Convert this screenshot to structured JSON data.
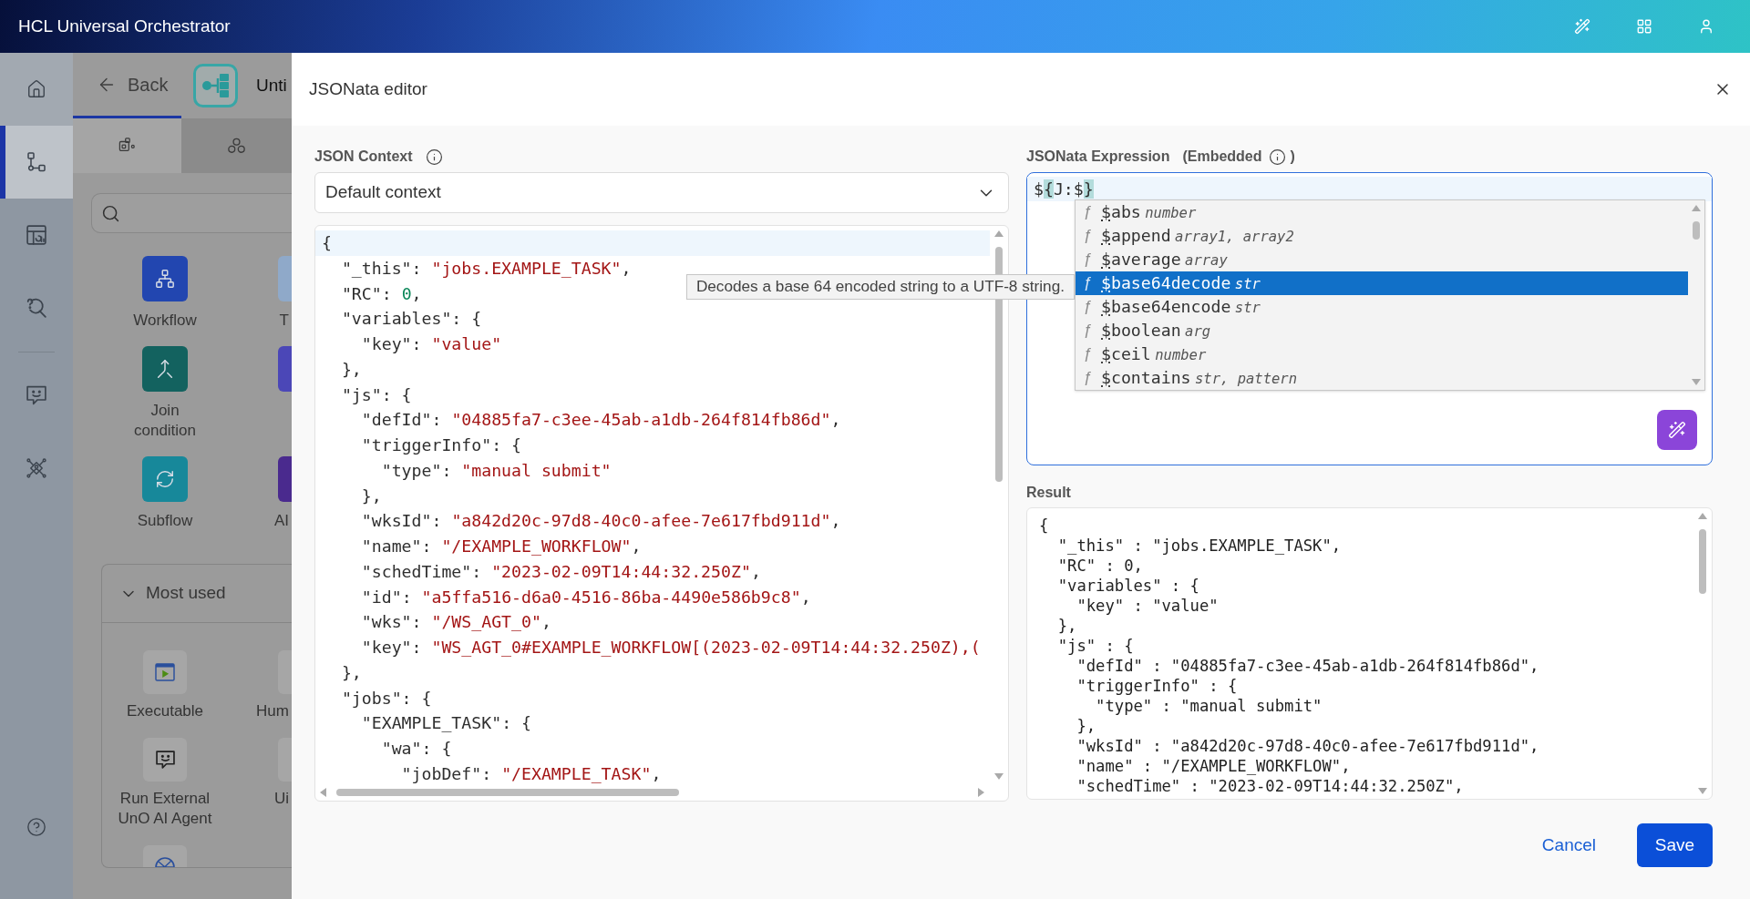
{
  "app_bar": {
    "title": "HCL Universal Orchestrator"
  },
  "nav_rail": {
    "items": [
      {
        "selected": false,
        "hovered": true
      },
      {
        "selected": true,
        "hovered": false
      },
      {
        "selected": false,
        "hovered": false
      },
      {
        "selected": false,
        "hovered": false
      },
      {
        "selected": false,
        "hovered": false
      },
      {
        "selected": false,
        "hovered": false
      }
    ]
  },
  "designer": {
    "back_label": "Back",
    "title": "Unti",
    "tabs": [
      {
        "selected": true
      },
      {
        "selected": false
      }
    ],
    "palette": [
      {
        "label": "Workflow",
        "color": "#2246b0"
      },
      {
        "label": "T",
        "color": "#8fa9c9"
      },
      {
        "label": "Join condition",
        "color": "#13625f"
      },
      {
        "color": "#4b47b7"
      },
      {
        "label": "Subflow",
        "color": "#17889a"
      },
      {
        "label": "AI",
        "color": "#4a2a8e"
      }
    ],
    "most_used": {
      "title": "Most used",
      "expanded": true,
      "items": [
        {
          "label": "Executable"
        },
        {
          "label": "Hum"
        },
        {
          "label": "Run External UnO AI Agent"
        },
        {
          "label": "Ui"
        }
      ]
    }
  },
  "dialog": {
    "title": "JSONata editor",
    "context": {
      "label": "JSON Context",
      "select_value": "Default context",
      "lines": [
        {
          "text": "{",
          "current": true
        },
        {
          "text": "  \"_this\": \"jobs.EXAMPLE_TASK\",",
          "current": false
        },
        {
          "text": "  \"RC\": 0,",
          "current": false
        },
        {
          "text": "  \"variables\": {",
          "current": false
        },
        {
          "text": "    \"key\": \"value\"",
          "current": false
        },
        {
          "text": "  },",
          "current": false
        },
        {
          "text": "  \"js\": {",
          "current": false
        },
        {
          "text": "    \"defId\": \"04885fa7-c3ee-45ab-a1db-264f814fb86d\",",
          "current": false
        },
        {
          "text": "    \"triggerInfo\": {",
          "current": false
        },
        {
          "text": "      \"type\": \"manual submit\"",
          "current": false
        },
        {
          "text": "    },",
          "current": false
        },
        {
          "text": "    \"wksId\": \"a842d20c-97d8-40c0-afee-7e617fbd911d\",",
          "current": false
        },
        {
          "text": "    \"name\": \"/EXAMPLE_WORKFLOW\",",
          "current": false
        },
        {
          "text": "    \"schedTime\": \"2023-02-09T14:44:32.250Z\",",
          "current": false
        },
        {
          "text": "    \"id\": \"a5ffa516-d6a0-4516-86ba-4490e586b9c8\",",
          "current": false
        },
        {
          "text": "    \"wks\": \"/WS_AGT_0\",",
          "current": false
        },
        {
          "text": "    \"key\": \"WS_AGT_0#EXAMPLE_WORKFLOW[(2023-02-09T14:44:32.250Z),(",
          "current": false
        },
        {
          "text": "  },",
          "current": false
        },
        {
          "text": "  \"jobs\": {",
          "current": false
        },
        {
          "text": "    \"EXAMPLE_TASK\": {",
          "current": false
        },
        {
          "text": "      \"wa\": {",
          "current": false
        },
        {
          "text": "        \"jobDef\": \"/EXAMPLE_TASK\",",
          "current": false
        }
      ]
    },
    "expression": {
      "label": "JSONata Expression",
      "note_open": "(Embedded",
      "note_close": ")",
      "value": "${J:$}",
      "current": true,
      "suggestions": [
        {
          "symbol": "ƒ",
          "name": "$abs",
          "params": "number",
          "selected": false
        },
        {
          "symbol": "ƒ",
          "name": "$append",
          "params": "array1, array2",
          "selected": false
        },
        {
          "symbol": "ƒ",
          "name": "$average",
          "params": "array",
          "selected": false
        },
        {
          "symbol": "ƒ",
          "name": "$base64decode",
          "params": "str",
          "selected": true
        },
        {
          "symbol": "ƒ",
          "name": "$base64encode",
          "params": "str",
          "selected": false
        },
        {
          "symbol": "ƒ",
          "name": "$boolean",
          "params": "arg",
          "selected": false
        },
        {
          "symbol": "ƒ",
          "name": "$ceil",
          "params": "number",
          "selected": false
        },
        {
          "symbol": "ƒ",
          "name": "$contains",
          "params": "str, pattern",
          "selected": false
        }
      ],
      "tooltip": "Decodes a base 64 encoded string to a UTF-8 string."
    },
    "result": {
      "label": "Result",
      "lines": [
        "{",
        "  \"_this\" : \"jobs.EXAMPLE_TASK\",",
        "  \"RC\" : 0,",
        "  \"variables\" : {",
        "    \"key\" : \"value\"",
        "  },",
        "  \"js\" : {",
        "    \"defId\" : \"04885fa7-c3ee-45ab-a1db-264f814fb86d\",",
        "    \"triggerInfo\" : {",
        "      \"type\" : \"manual submit\"",
        "    },",
        "    \"wksId\" : \"a842d20c-97d8-40c0-afee-7e617fbd911d\",",
        "    \"name\" : \"/EXAMPLE_WORKFLOW\",",
        "    \"schedTime\" : \"2023-02-09T14:44:32.250Z\","
      ]
    },
    "buttons": [
      {
        "label": "Cancel",
        "kind": "link"
      },
      {
        "label": "Save",
        "kind": "primary"
      }
    ]
  }
}
